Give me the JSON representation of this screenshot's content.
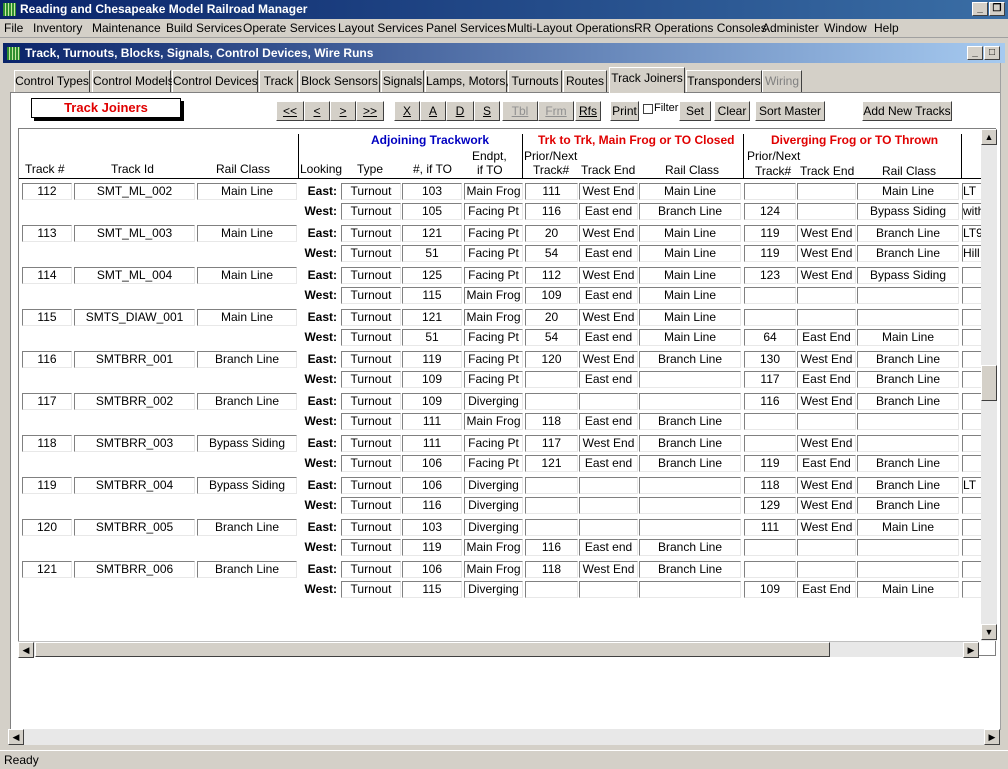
{
  "app": {
    "title": "Reading and Chesapeake Model Railroad Manager"
  },
  "menu": [
    "File",
    "Inventory",
    "Maintenance",
    "Build Services",
    "Operate Services",
    "Layout Services",
    "Panel Services",
    "Multi-Layout Operations",
    "RR Operations Consoles",
    "Administer",
    "Window",
    "Help"
  ],
  "window": {
    "title": "Track, Turnouts, Blocks, Signals, Control Devices, Wire Runs"
  },
  "tabs": [
    {
      "label": "Control Types",
      "state": "normal"
    },
    {
      "label": "Control Models",
      "state": "normal"
    },
    {
      "label": "Control Devices",
      "state": "normal"
    },
    {
      "label": "Track",
      "state": "normal"
    },
    {
      "label": "Block Sensors",
      "state": "normal"
    },
    {
      "label": "Signals",
      "state": "normal"
    },
    {
      "label": "Lamps, Motors,",
      "state": "normal"
    },
    {
      "label": "Turnouts",
      "state": "normal"
    },
    {
      "label": "Routes",
      "state": "normal"
    },
    {
      "label": "Track Joiners",
      "state": "active"
    },
    {
      "label": "Transponders",
      "state": "normal"
    },
    {
      "label": "Wiring",
      "state": "disabled"
    }
  ],
  "section_label": "Track Joiners",
  "nav_buttons": [
    "<<",
    "<",
    ">",
    ">>",
    "X",
    "A",
    "D",
    "S",
    "Tbl",
    "Frm",
    "Rfs"
  ],
  "nav_disabled": [
    "Tbl",
    "Frm"
  ],
  "toolbar": {
    "print": "Print",
    "filter": "Filter",
    "set": "Set",
    "clear": "Clear",
    "sort_master": "Sort Master",
    "add_new_tracks": "Add New Tracks"
  },
  "group_headers": {
    "adjoining": "Adjoining Trackwork",
    "closed": "Trk to Trk, Main Frog or TO Closed",
    "thrown": "Diverging Frog or TO Thrown"
  },
  "group_colors": {
    "adjoining": "#0000c0",
    "closed": "#e00000",
    "thrown": "#e00000"
  },
  "columns": {
    "track_num": "Track #",
    "track_id": "Track Id",
    "rail_class": "Rail Class",
    "looking": "Looking",
    "type": "Type",
    "num_if_to": "#, if TO",
    "endpt_1": "Endpt,",
    "endpt_2": "if TO",
    "prior_next": "Prior/Next",
    "track_num2": "Track#",
    "track_end": "Track End",
    "rail_class2": "Rail Class",
    "prior_next2": "Prior/Next",
    "track_num3": "Track#",
    "track_end3": "Track End",
    "rail_class3": "Rail Class"
  },
  "rows": [
    {
      "track": "112",
      "id": "SMT_ML_002",
      "cls": "Main Line",
      "extra": [
        "LT",
        "with"
      ],
      "east": [
        "Turnout",
        "103",
        "Main Frog",
        "111",
        "West End",
        "Main Line",
        "",
        "",
        "Main Line"
      ],
      "west": [
        "Turnout",
        "105",
        "Facing Pt",
        "116",
        "East end",
        "Branch Line",
        "124",
        "",
        "Bypass Siding"
      ]
    },
    {
      "track": "113",
      "id": "SMT_ML_003",
      "cls": "Main Line",
      "extra": [
        "LT9",
        "Hill"
      ],
      "east": [
        "Turnout",
        "121",
        "Facing Pt",
        "20",
        "West End",
        "Main Line",
        "119",
        "West End",
        "Branch Line"
      ],
      "west": [
        "Turnout",
        "51",
        "Facing Pt",
        "54",
        "East end",
        "Main Line",
        "119",
        "West End",
        "Branch Line"
      ]
    },
    {
      "track": "114",
      "id": "SMT_ML_004",
      "cls": "Main Line",
      "extra": [
        "",
        ""
      ],
      "east": [
        "Turnout",
        "125",
        "Facing Pt",
        "112",
        "West End",
        "Main Line",
        "123",
        "West End",
        "Bypass Siding"
      ],
      "west": [
        "Turnout",
        "115",
        "Main Frog",
        "109",
        "East end",
        "Main Line",
        "",
        "",
        ""
      ]
    },
    {
      "track": "115",
      "id": "SMTS_DIAW_001",
      "cls": "Main Line",
      "extra": [
        "",
        ""
      ],
      "east": [
        "Turnout",
        "121",
        "Main Frog",
        "20",
        "West End",
        "Main Line",
        "",
        "",
        ""
      ],
      "west": [
        "Turnout",
        "51",
        "Facing Pt",
        "54",
        "East end",
        "Main Line",
        "64",
        "East End",
        "Main Line"
      ]
    },
    {
      "track": "116",
      "id": "SMTBRR_001",
      "cls": "Branch Line",
      "extra": [
        "",
        ""
      ],
      "east": [
        "Turnout",
        "119",
        "Facing Pt",
        "120",
        "West End",
        "Branch Line",
        "130",
        "West End",
        "Branch Line"
      ],
      "west": [
        "Turnout",
        "109",
        "Facing Pt",
        "",
        "East end",
        "",
        "117",
        "East End",
        "Branch Line"
      ]
    },
    {
      "track": "117",
      "id": "SMTBRR_002",
      "cls": "Branch Line",
      "extra": [
        "",
        ""
      ],
      "east": [
        "Turnout",
        "109",
        "Diverging",
        "",
        "",
        "",
        "116",
        "West End",
        "Branch Line"
      ],
      "west": [
        "Turnout",
        "111",
        "Main Frog",
        "118",
        "East end",
        "Branch Line",
        "",
        "",
        ""
      ]
    },
    {
      "track": "118",
      "id": "SMTBRR_003",
      "cls": "Bypass Siding",
      "extra": [
        "",
        ""
      ],
      "east": [
        "Turnout",
        "111",
        "Facing Pt",
        "117",
        "West End",
        "Branch Line",
        "",
        "West End",
        ""
      ],
      "west": [
        "Turnout",
        "106",
        "Facing Pt",
        "121",
        "East end",
        "Branch Line",
        "119",
        "East End",
        "Branch Line"
      ]
    },
    {
      "track": "119",
      "id": "SMTBRR_004",
      "cls": "Bypass Siding",
      "extra": [
        "LT",
        ""
      ],
      "east": [
        "Turnout",
        "106",
        "Diverging",
        "",
        "",
        "",
        "118",
        "West End",
        "Branch Line"
      ],
      "west": [
        "Turnout",
        "116",
        "Diverging",
        "",
        "",
        "",
        "129",
        "West End",
        "Branch Line"
      ]
    },
    {
      "track": "120",
      "id": "SMTBRR_005",
      "cls": "Branch Line",
      "extra": [
        "",
        ""
      ],
      "east": [
        "Turnout",
        "103",
        "Diverging",
        "",
        "",
        "",
        "111",
        "West End",
        "Main Line"
      ],
      "west": [
        "Turnout",
        "119",
        "Main Frog",
        "116",
        "East end",
        "Branch Line",
        "",
        "",
        ""
      ]
    },
    {
      "track": "121",
      "id": "SMTBRR_006",
      "cls": "Branch Line",
      "extra": [
        "",
        ""
      ],
      "east": [
        "Turnout",
        "106",
        "Main Frog",
        "118",
        "West End",
        "Branch Line",
        "",
        "",
        ""
      ],
      "west": [
        "Turnout",
        "115",
        "Diverging",
        "",
        "",
        "",
        "109",
        "East End",
        "Main Line"
      ]
    }
  ],
  "look_labels": {
    "east": "East:",
    "west": "West:"
  },
  "status": "Ready"
}
